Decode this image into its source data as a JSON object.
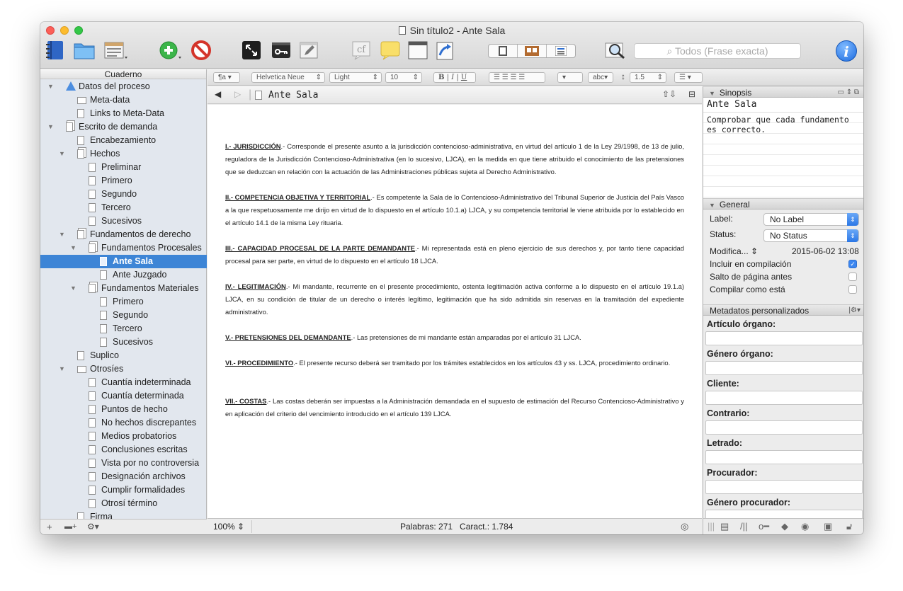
{
  "window": {
    "title": "Sin título2 - Ante Sala"
  },
  "toolbar": {
    "search_placeholder": "Todos (Frase exacta)",
    "cf_label": "cf",
    "info_label": "i"
  },
  "format_bar": {
    "style": "¶a",
    "font": "Helvetica Neue",
    "weight": "Light",
    "size": "10",
    "bold": "B",
    "italic": "I",
    "underline": "U",
    "highlight": "abc",
    "line_spacing": "1.5"
  },
  "sidebar": {
    "header": "Cuaderno",
    "items": [
      {
        "label": "Datos del proceso",
        "level": 0,
        "icon": "warning-icon",
        "arrow": "▼"
      },
      {
        "label": "Meta-data",
        "level": 1,
        "icon": "meta-icon",
        "arrow": ""
      },
      {
        "label": "Links to Meta-Data",
        "level": 1,
        "icon": "doc-icon",
        "arrow": ""
      },
      {
        "label": "Escrito de demanda",
        "level": 0,
        "icon": "folder-doc-icon",
        "arrow": "▼"
      },
      {
        "label": "Encabezamiento",
        "level": 1,
        "icon": "doc-icon",
        "arrow": ""
      },
      {
        "label": "Hechos",
        "level": 1,
        "icon": "folder-doc-icon",
        "arrow": "▼"
      },
      {
        "label": "Preliminar",
        "level": 2,
        "icon": "doc-icon",
        "arrow": ""
      },
      {
        "label": "Primero",
        "level": 2,
        "icon": "doc-icon",
        "arrow": ""
      },
      {
        "label": "Segundo",
        "level": 2,
        "icon": "doc-icon",
        "arrow": ""
      },
      {
        "label": "Tercero",
        "level": 2,
        "icon": "doc-icon",
        "arrow": ""
      },
      {
        "label": "Sucesivos",
        "level": 2,
        "icon": "doc-icon",
        "arrow": ""
      },
      {
        "label": "Fundamentos de derecho",
        "level": 1,
        "icon": "folder-doc-icon",
        "arrow": "▼"
      },
      {
        "label": "Fundamentos Procesales",
        "level": 2,
        "icon": "folder-doc-icon",
        "arrow": "▼"
      },
      {
        "label": "Ante Sala",
        "level": 3,
        "icon": "doc-icon",
        "arrow": "",
        "selected": true
      },
      {
        "label": "Ante Juzgado",
        "level": 3,
        "icon": "doc-icon",
        "arrow": ""
      },
      {
        "label": "Fundamentos Materiales",
        "level": 2,
        "icon": "folder-doc-icon",
        "arrow": "▼"
      },
      {
        "label": "Primero",
        "level": 3,
        "icon": "doc-icon",
        "arrow": ""
      },
      {
        "label": "Segundo",
        "level": 3,
        "icon": "doc-icon",
        "arrow": ""
      },
      {
        "label": "Tercero",
        "level": 3,
        "icon": "doc-icon",
        "arrow": ""
      },
      {
        "label": "Sucesivos",
        "level": 3,
        "icon": "doc-icon",
        "arrow": ""
      },
      {
        "label": "Suplico",
        "level": 1,
        "icon": "doc-icon",
        "arrow": ""
      },
      {
        "label": "Otrosíes",
        "level": 1,
        "icon": "folder-icon",
        "arrow": "▼"
      },
      {
        "label": "Cuantía indeterminada",
        "level": 2,
        "icon": "doc-icon",
        "arrow": ""
      },
      {
        "label": "Cuantía determinada",
        "level": 2,
        "icon": "doc-icon",
        "arrow": ""
      },
      {
        "label": "Puntos de hecho",
        "level": 2,
        "icon": "doc-icon",
        "arrow": ""
      },
      {
        "label": "No hechos discrepantes",
        "level": 2,
        "icon": "doc-icon",
        "arrow": ""
      },
      {
        "label": "Medios probatorios",
        "level": 2,
        "icon": "doc-icon",
        "arrow": ""
      },
      {
        "label": "Conclusiones escritas",
        "level": 2,
        "icon": "doc-icon",
        "arrow": ""
      },
      {
        "label": "Vista por no controversia",
        "level": 2,
        "icon": "doc-icon",
        "arrow": ""
      },
      {
        "label": "Designación archivos",
        "level": 2,
        "icon": "doc-icon",
        "arrow": ""
      },
      {
        "label": "Cumplir formalidades",
        "level": 2,
        "icon": "doc-icon",
        "arrow": ""
      },
      {
        "label": "Otrosí término",
        "level": 2,
        "icon": "doc-icon",
        "arrow": ""
      },
      {
        "label": "Firma",
        "level": 1,
        "icon": "doc-icon",
        "arrow": ""
      }
    ]
  },
  "editor": {
    "doc_title": "Ante Sala",
    "paragraphs": [
      {
        "heading": "I.- JURISDICCIÓN",
        "text": ".- Corresponde el presente asunto a la jurisdicción contencioso-administrativa, en virtud del artículo 1 de la Ley 29/1998, de 13 de julio, reguladora de la Jurisdicción Contencioso-Administrativa (en lo sucesivo, LJCA), en la medida en que tiene atribuido el conocimiento de las pretensiones que se deduzcan en relación con la actuación de las Administraciones públicas sujeta al Derecho Administrativo."
      },
      {
        "heading": "II.- COMPETENCIA OBJETIVA Y TERRITORIAL",
        "text": ".- Es competente la Sala de lo Contencioso-Administrativo del Tribunal Superior de Justicia del País Vasco a la que respetuosamente me dirijo en virtud de lo dispuesto en el artículo 10.1.a) LJCA, y su competencia territorial le viene atribuida por lo establecido en el artículo 14.1 de la misma Ley rituaria."
      },
      {
        "heading": "III.- CAPACIDAD PROCESAL DE LA PARTE DEMANDANTE",
        "text": ".- Mi representada está en pleno ejercicio de sus derechos y, por tanto tiene capacidad procesal para ser parte, en virtud de lo dispuesto en el artículo 18 LJCA."
      },
      {
        "heading": "IV.- LEGITIMACIÓN",
        "text": ".- Mi mandante, recurrente en el presente procedimiento, ostenta legitimación activa conforme a lo dispuesto en el artículo 19.1.a) LJCA, en su condición de titular de un derecho o interés legítimo, legitimación que ha sido admitida sin reservas en la tramitación del expediente administrativo."
      },
      {
        "heading": "V.- PRETENSIONES DEL DEMANDANTE",
        "text": ".- Las pretensiones de mi mandante están amparadas por el artículo 31 LJCA."
      },
      {
        "heading": "VI.- PROCEDIMIENTO",
        "text": ".- El presente recurso deberá ser tramitado por los trámites establecidos en los artículos 43 y ss. LJCA, procedimiento ordinario."
      },
      {
        "heading": "VII.- COSTAS",
        "text": ".- Las costas deberán ser impuestas a la Administración demandada en el supuesto de estimación del Recurso Contencioso-Administrativo y en aplicación del criterio del vencimiento introducido en el artículo 139 LJCA."
      }
    ],
    "zoom": "100%",
    "stats": "Palabras: 271   Caract.: 1.784"
  },
  "inspector": {
    "synopsis_header": "Sinopsis",
    "synopsis_title": "Ante Sala",
    "synopsis_text": "Comprobar que cada fundamento es correcto.",
    "general_header": "General",
    "label_label": "Label:",
    "label_value": "No Label",
    "status_label": "Status:",
    "status_value": "No Status",
    "modified_label": "Modifica...",
    "modified_value": "2015-06-02 13:08",
    "include_label": "Incluir en compilación",
    "include_checked": true,
    "pagebreak_label": "Salto de página antes",
    "pagebreak_checked": false,
    "asis_label": "Compilar como está",
    "asis_checked": false,
    "metadata_header": "Metadatos personalizados",
    "metadata_fields": [
      "Artículo órgano:",
      "Género órgano:",
      "Cliente:",
      "Contrario:",
      "Letrado:",
      "Procurador:",
      "Género procurador:"
    ]
  },
  "colors": {
    "accent": "#3d85d6",
    "sidebar_bg": "#e2e7ee"
  }
}
